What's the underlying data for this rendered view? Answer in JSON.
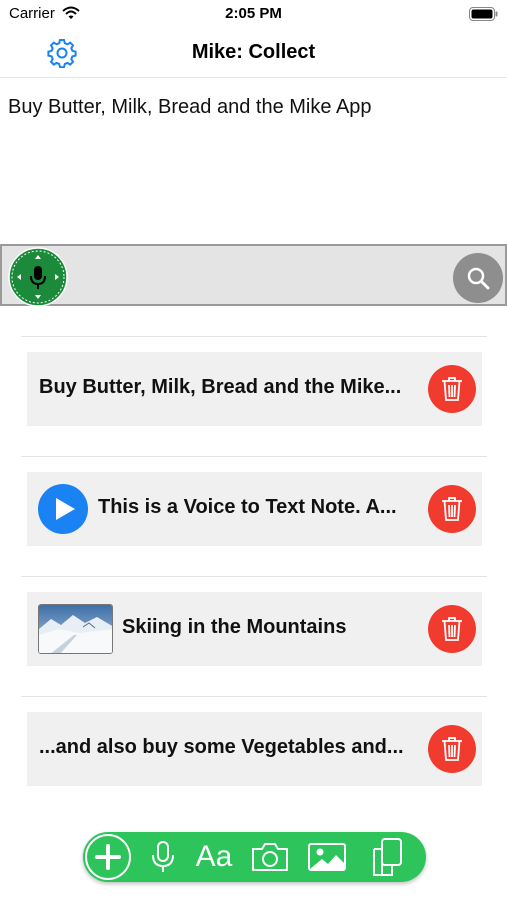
{
  "status_bar": {
    "carrier": "Carrier",
    "time": "2:05 PM",
    "icons": [
      "wifi-icon",
      "battery-icon"
    ]
  },
  "nav": {
    "title": "Mike: Collect",
    "settings_icon": "gear-icon"
  },
  "note_input": {
    "text": "Buy Butter, Milk, Bread and the Mike App"
  },
  "search_bar": {
    "logo_icon": "mike-logo-icon",
    "search_icon": "search-icon"
  },
  "notes": [
    {
      "type": "text",
      "title": "Buy Butter, Milk, Bread and the Mike...",
      "action_icon": "trash-icon"
    },
    {
      "type": "voice",
      "title": "This is a Voice to Text Note. A...",
      "lead_icon": "play-icon",
      "action_icon": "trash-icon"
    },
    {
      "type": "photo",
      "title": "Skiing in the Mountains",
      "lead_icon": "ski-photo-thumbnail",
      "action_icon": "trash-icon"
    },
    {
      "type": "text",
      "title": "...and also buy some Vegetables and...",
      "action_icon": "trash-icon"
    }
  ],
  "toolbar": {
    "text_tool_label": "Aa",
    "icons": [
      "plus-icon",
      "microphone-icon",
      "text-icon",
      "camera-icon",
      "image-icon",
      "documents-icon"
    ]
  },
  "colors": {
    "accent_blue": "#1a82f2",
    "delete_red": "#f23b2f",
    "toolbar_green": "#2cc45b",
    "logo_green": "#1b8a3a",
    "search_gray": "#8e8e8e",
    "card_gray": "#f0f0f0"
  }
}
